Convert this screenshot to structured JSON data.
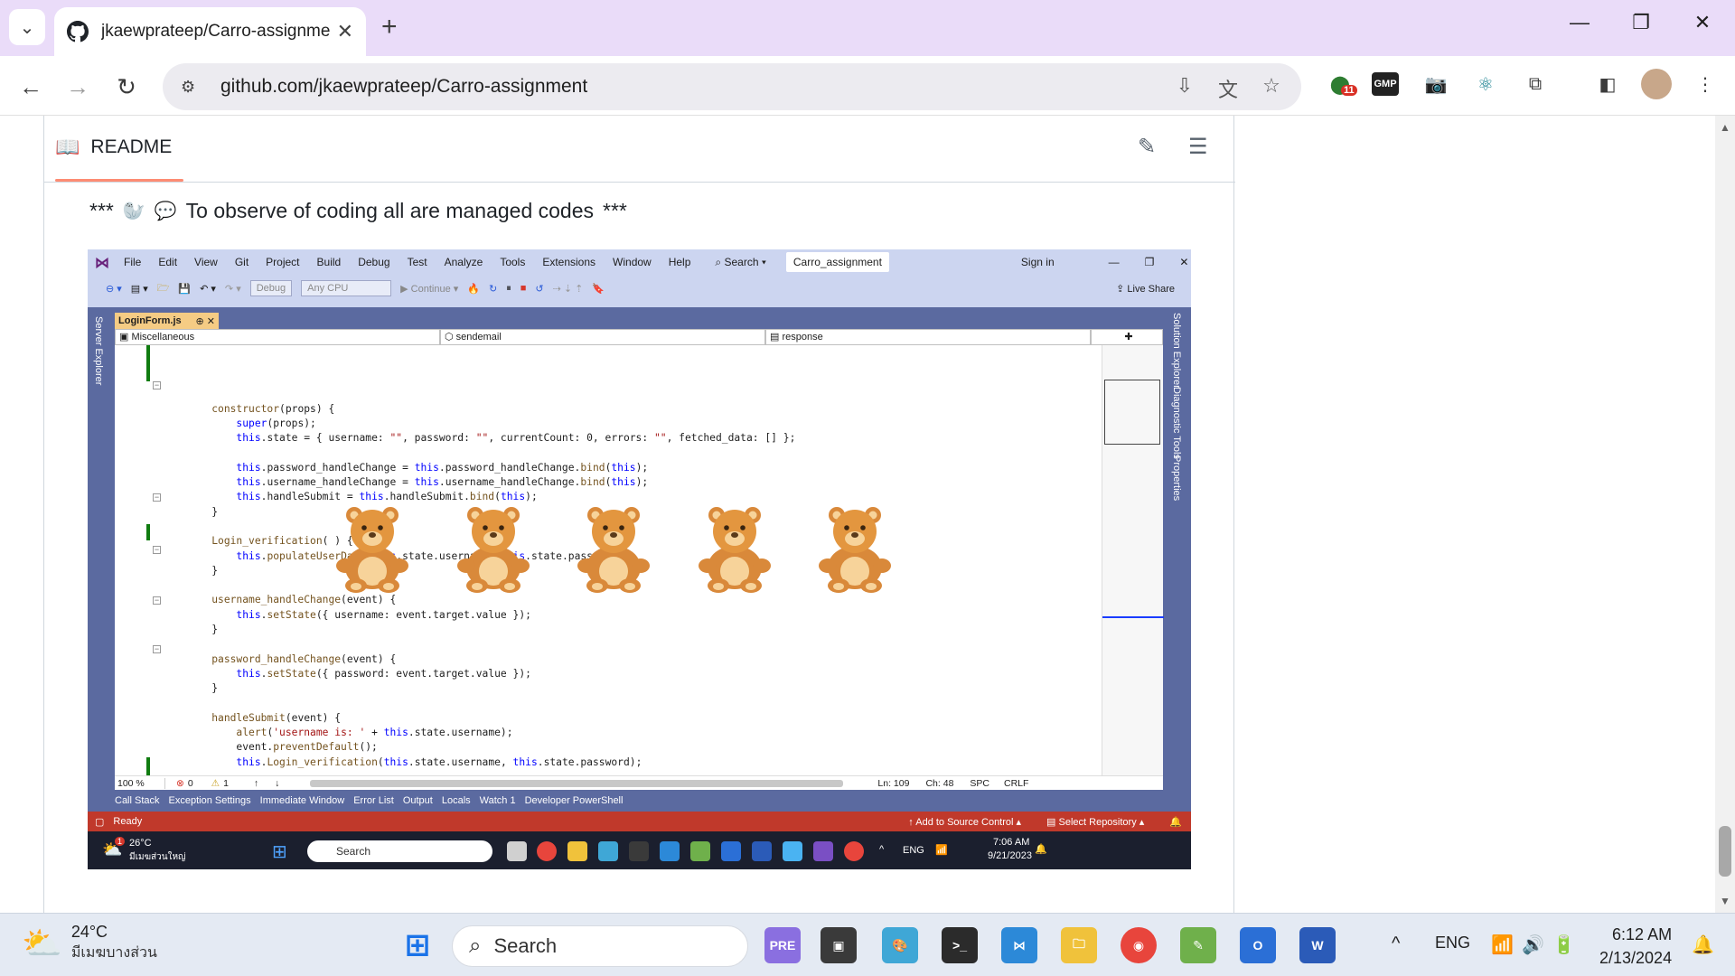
{
  "browser": {
    "tab_title": "jkaewprateep/Carro-assignment",
    "url": "github.com/jkaewprateep/Carro-assignment",
    "extension_badge": "11",
    "ext_gmp_label": "GMP"
  },
  "readme": {
    "header": "README",
    "line_prefix": "***",
    "line_text": "To observe of coding all are managed codes",
    "line_suffix": "***"
  },
  "vs": {
    "menu": [
      "File",
      "Edit",
      "View",
      "Git",
      "Project",
      "Build",
      "Debug",
      "Test",
      "Analyze",
      "Tools",
      "Extensions",
      "Window",
      "Help"
    ],
    "search_label": "Search",
    "solution_name": "Carro_assignment",
    "sign_in": "Sign in",
    "config_drop": "Debug",
    "platform_drop": "Any CPU",
    "continue_label": "Continue",
    "live_share": "Live Share",
    "left_panel": "Server Explorer",
    "right_panels": [
      "Solution Explorer",
      "Diagnostic Tools",
      "Properties"
    ],
    "doc_tab": "LoginForm.js",
    "nav_scope": "Miscellaneous",
    "nav_member": "sendemail",
    "nav_field": "response",
    "zoom": "100 %",
    "errors": "0",
    "warnings": "1",
    "ln": "Ln: 109",
    "ch": "Ch: 48",
    "spc": "SPC",
    "crlf": "CRLF",
    "bottom_tabs": [
      "Call Stack",
      "Exception Settings",
      "Immediate Window",
      "Error List",
      "Output",
      "Locals",
      "Watch 1",
      "Developer PowerShell"
    ],
    "status_ready": "Ready",
    "status_source": "Add to Source Control",
    "status_repo": "Select Repository",
    "inner_weather_temp": "26°C",
    "inner_weather_cond": "มีเมฆส่วนใหญ่",
    "inner_search": "Search",
    "inner_lang": "ENG",
    "inner_time": "7:06 AM",
    "inner_date": "9/21/2023",
    "inner_badge": "1"
  },
  "code_lines": [
    "",
    "",
    "    constructor(props) {",
    "        super(props);",
    "        this.state = { username: \"\", password: \"\", currentCount: 0, errors: \"\", fetched_data: [] };",
    "",
    "        this.password_handleChange = this.password_handleChange.bind(this);",
    "        this.username_handleChange = this.username_handleChange.bind(this);",
    "        this.handleSubmit = this.handleSubmit.bind(this);",
    "    }",
    "",
    "    Login_verification( ) {",
    "        this.populateUserData(this.state.username, this.state.password);",
    "    }",
    "",
    "    username_handleChange(event) {",
    "        this.setState({ username: event.target.value });",
    "    }",
    "",
    "    password_handleChange(event) {",
    "        this.setState({ password: event.target.value });",
    "    }",
    "",
    "    handleSubmit(event) {",
    "        alert('username is: ' + this.state.username);",
    "        event.preventDefault();",
    "        this.Login_verification(this.state.username, this.state.password);"
  ],
  "taskbar": {
    "temp": "24°C",
    "condition": "มีเมฆบางส่วน",
    "search": "Search",
    "lang": "ENG",
    "time": "6:12 AM",
    "date": "2/13/2024"
  }
}
